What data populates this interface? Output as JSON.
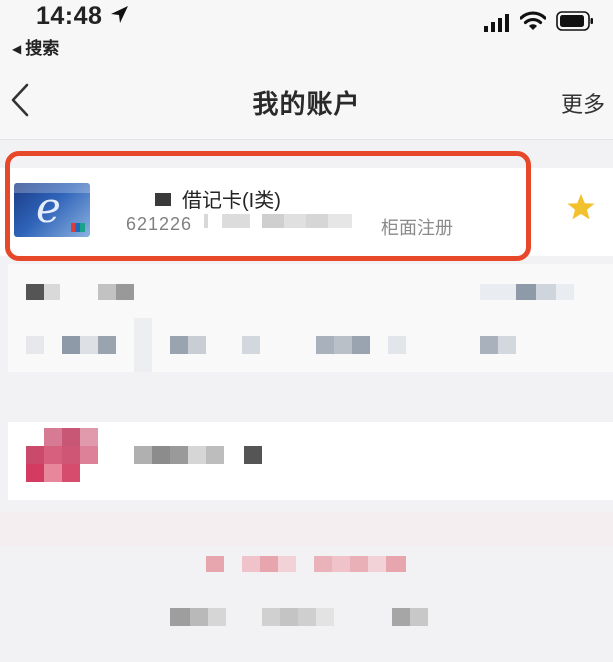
{
  "status_bar": {
    "time": "14:48",
    "back_app_label": "搜索"
  },
  "nav": {
    "title": "我的账户",
    "more_label": "更多"
  },
  "account": {
    "card_type": "借记卡(I类)",
    "card_number_prefix": "621226",
    "registration": "柜面注册"
  },
  "colors": {
    "highlight": "#e8482a",
    "star": "#f2c12e"
  }
}
